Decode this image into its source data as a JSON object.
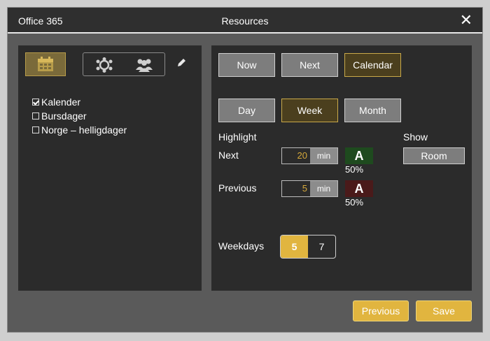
{
  "window": {
    "app_name": "Office 365",
    "title": "Resources",
    "close_icon": "close-icon"
  },
  "left_panel": {
    "icons": [
      "calendar-icon",
      "meeting-room-icon",
      "people-icon",
      "pencil-icon"
    ],
    "calendars": [
      {
        "label": "Kalender",
        "checked": true
      },
      {
        "label": "Bursdager",
        "checked": false
      },
      {
        "label": "Norge – helligdager",
        "checked": false
      }
    ]
  },
  "right_panel": {
    "time_buttons": {
      "now": "Now",
      "next": "Next",
      "calendar": "Calendar",
      "selected": "Calendar"
    },
    "view_buttons": {
      "day": "Day",
      "week": "Week",
      "month": "Month",
      "selected": "Week"
    },
    "highlight": {
      "heading": "Highlight",
      "next": {
        "label": "Next",
        "value": "20",
        "unit": "min",
        "swatch_letter": "A",
        "swatch_color": "#1e4a1e",
        "opacity": "50%"
      },
      "previous": {
        "label": "Previous",
        "value": "5",
        "unit": "min",
        "swatch_letter": "A",
        "swatch_color": "#4a1a1a",
        "opacity": "50%"
      }
    },
    "show": {
      "heading": "Show",
      "button": "Room"
    },
    "weekdays": {
      "label": "Weekdays",
      "options": [
        "5",
        "7"
      ],
      "selected": "5"
    }
  },
  "footer": {
    "previous": "Previous",
    "save": "Save"
  },
  "colors": {
    "accent": "#e1b53f",
    "panel": "#2b2b2b",
    "dialog": "#5a5a5a"
  }
}
